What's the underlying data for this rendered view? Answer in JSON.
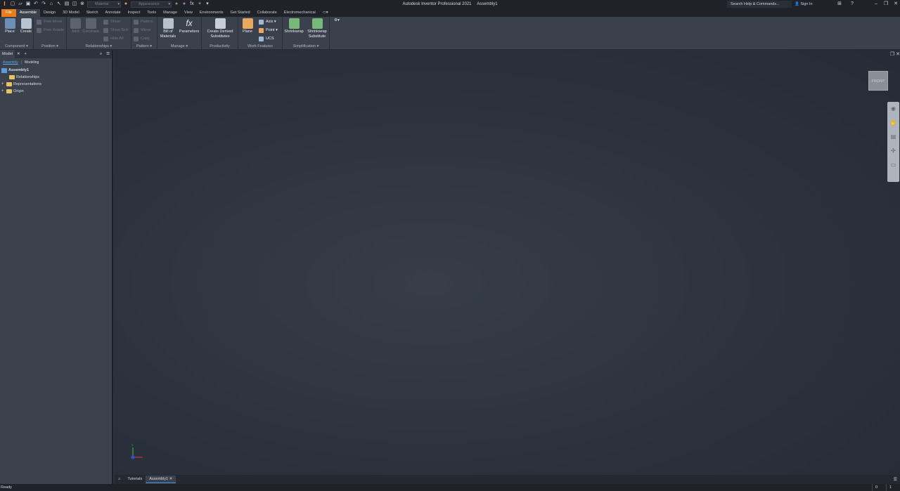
{
  "app": {
    "title": "Autodesk Inventor Professional 2021",
    "document": "Assembly1"
  },
  "quick_access": {
    "material_placeholder": "Material",
    "appearance_placeholder": "Appearance",
    "fx": "fx"
  },
  "header": {
    "search_placeholder": "Search Help & Commands...",
    "sign_in": "Sign In"
  },
  "ribbon_tabs": [
    "File",
    "Assemble",
    "Design",
    "3D Model",
    "Sketch",
    "Annotate",
    "Inspect",
    "Tools",
    "Manage",
    "View",
    "Environments",
    "Get Started",
    "Collaborate",
    "Electromechanical"
  ],
  "ribbon": {
    "component": {
      "label": "Component",
      "place": "Place",
      "create": "Create"
    },
    "position": {
      "label": "Position",
      "free_move": "Free Move",
      "free_rotate": "Free Rotate"
    },
    "relationships": {
      "label": "Relationships",
      "joint": "Joint",
      "constrain": "Constrain",
      "show": "Show",
      "show_sick": "Show Sick",
      "hide_all": "Hide All"
    },
    "pattern": {
      "label": "Pattern",
      "pattern": "Pattern",
      "mirror": "Mirror",
      "copy": "Copy"
    },
    "manage": {
      "label": "Manage",
      "bom_line1": "Bill of",
      "bom_line2": "Materials",
      "parameters": "Parameters"
    },
    "productivity": {
      "label": "Productivity",
      "line1": "Create Derived",
      "line2": "Substitutes"
    },
    "work_features": {
      "label": "Work Features",
      "plane": "Plane",
      "axis": "Axis",
      "point": "Point",
      "ucs": "UCS"
    },
    "simplification": {
      "label": "Simplification",
      "shrinkwrap": "Shrinkwrap",
      "sub_line1": "Shrinkwrap",
      "sub_line2": "Substitute"
    }
  },
  "browser": {
    "tab": "Model",
    "subtabs": [
      "Assembly",
      "Modeling"
    ],
    "tree": [
      "Assembly1",
      "Relationships",
      "Representations",
      "Origin"
    ]
  },
  "viewport": {
    "viewcube_label": "FRONT"
  },
  "document_tabs": [
    "Tutorials",
    "Assembly1"
  ],
  "status": {
    "text": "Ready",
    "count1": "0",
    "count2": "1"
  },
  "colors": {
    "accent_file": "#e87d1e",
    "active_blue": "#4aa3e8",
    "viewport_bg": "#2b313d"
  }
}
